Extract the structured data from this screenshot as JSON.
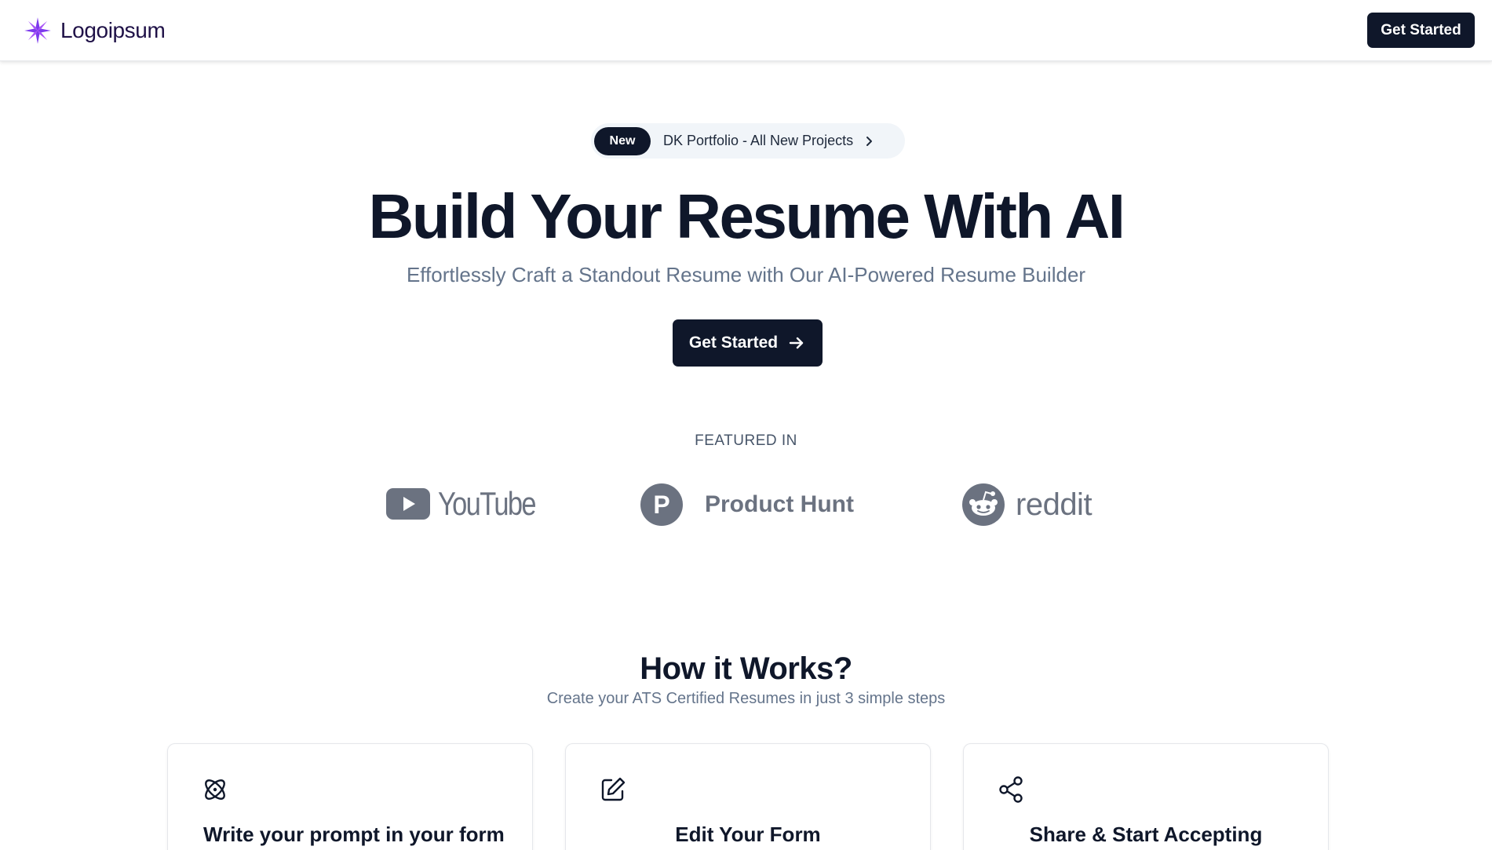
{
  "header": {
    "logo_text": "Logoipsum",
    "cta_label": "Get Started"
  },
  "announcement": {
    "badge": "New",
    "text": "DK Portfolio - All New Projects",
    "icon": "chevron-right-icon"
  },
  "hero": {
    "title": "Build Your Resume With AI",
    "subtitle": "Effortlessly Craft a Standout Resume with Our AI-Powered Resume Builder",
    "cta_label": "Get Started",
    "cta_icon": "arrow-right-icon"
  },
  "featured": {
    "label": "FEATURED IN",
    "brands": [
      {
        "name": "YouTube",
        "icon": "youtube-icon"
      },
      {
        "name": "Product Hunt",
        "icon": "product-hunt-icon",
        "mark": "P"
      },
      {
        "name": "reddit",
        "icon": "reddit-icon"
      }
    ]
  },
  "how_it_works": {
    "title": "How it Works?",
    "subtitle": "Create your ATS Certified Resumes in just 3 simple steps",
    "steps": [
      {
        "title": "Write your prompt in your form",
        "icon": "atom-icon"
      },
      {
        "title": "Edit Your Form",
        "icon": "edit-icon"
      },
      {
        "title": "Share & Start Accepting",
        "icon": "share-icon"
      }
    ]
  },
  "colors": {
    "dark": "#0f172a",
    "muted": "#64748b",
    "brand_gray": "#6b7280",
    "logo_purple": "#7c3aed"
  }
}
